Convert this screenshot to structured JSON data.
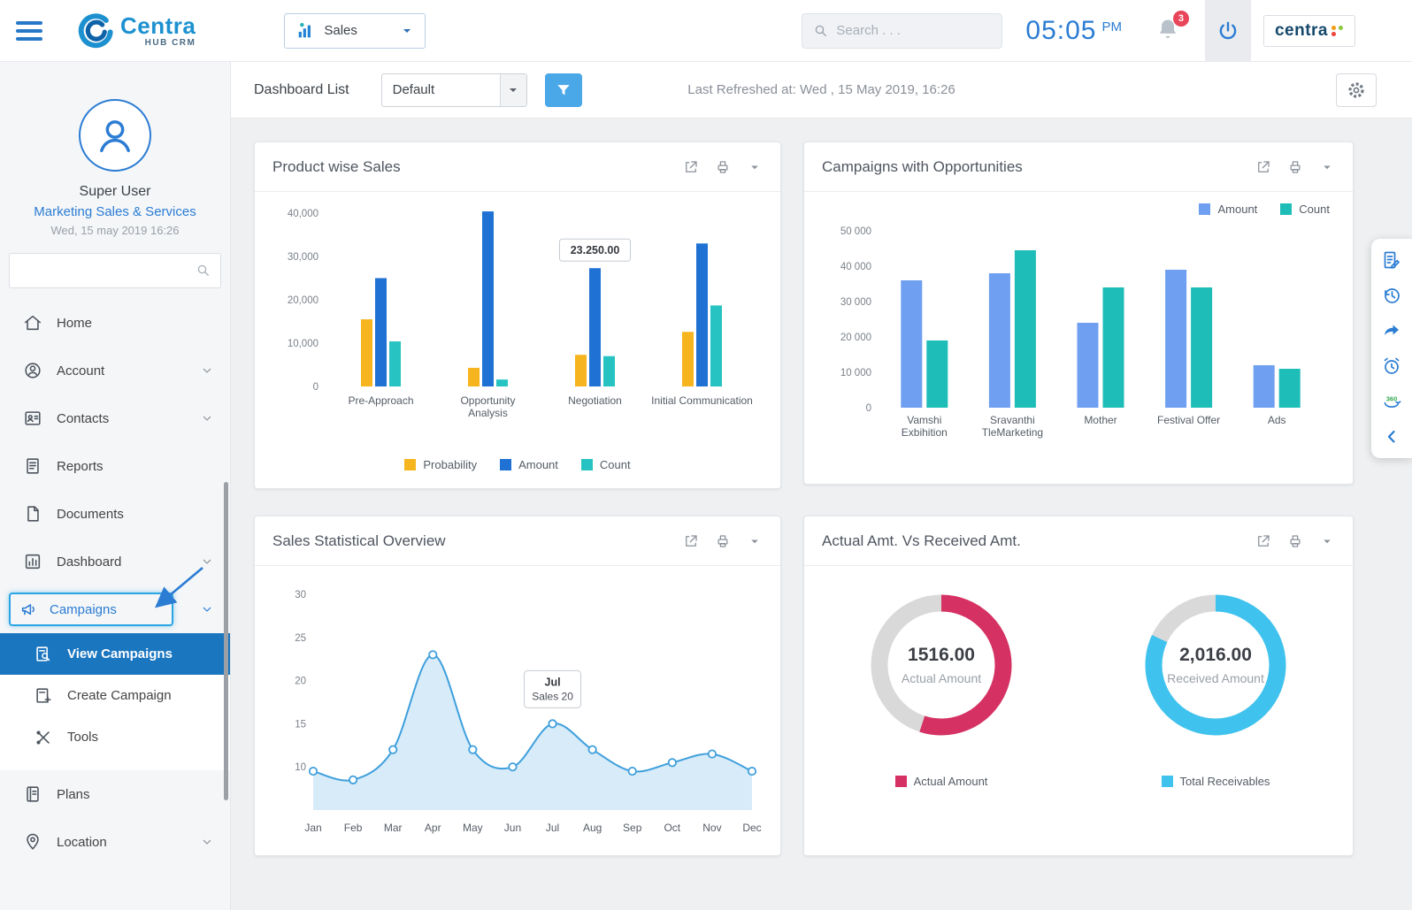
{
  "topbar": {
    "logo": {
      "name": "Centra",
      "sub": "HUB CRM"
    },
    "module_selector": {
      "value": "Sales"
    },
    "search": {
      "placeholder": "Search . . ."
    },
    "clock": {
      "time": "05:05",
      "period": "PM"
    },
    "notifications": {
      "count": "3"
    },
    "brand_right": "centra"
  },
  "filterbar": {
    "dashboard_list_label": "Dashboard List",
    "dashboard_selector": {
      "value": "Default"
    },
    "last_refreshed": "Last Refreshed at: Wed , 15 May 2019, 16:26"
  },
  "sidebar": {
    "user": {
      "name": "Super User",
      "role": "Marketing Sales & Services",
      "datetime": "Wed, 15 may 2019 16:26"
    },
    "items": [
      {
        "label": "Home",
        "icon": "home-icon",
        "expandable": false
      },
      {
        "label": "Account",
        "icon": "account-icon",
        "expandable": true
      },
      {
        "label": "Contacts",
        "icon": "contacts-icon",
        "expandable": true
      },
      {
        "label": "Reports",
        "icon": "reports-icon",
        "expandable": false
      },
      {
        "label": "Documents",
        "icon": "documents-icon",
        "expandable": false
      },
      {
        "label": "Dashboard",
        "icon": "dashboard-icon",
        "expandable": true
      },
      {
        "label": "Campaigns",
        "icon": "campaigns-icon",
        "expandable": true,
        "highlighted": true
      },
      {
        "label": "View Campaigns",
        "icon": "view-campaigns-icon",
        "submenu": true,
        "active": true
      },
      {
        "label": "Create Campaign",
        "icon": "create-campaign-icon",
        "submenu": true
      },
      {
        "label": "Tools",
        "icon": "tools-icon",
        "submenu": true
      },
      {
        "label": "Plans",
        "icon": "plans-icon",
        "expandable": false
      },
      {
        "label": "Location",
        "icon": "location-icon",
        "expandable": true
      }
    ]
  },
  "dock": {
    "items": [
      "activity-log-icon",
      "history-icon",
      "share-icon",
      "reminder-icon",
      "view-360-icon",
      "collapse-dock-icon"
    ]
  },
  "chart_data": [
    {
      "id": "product-wise-sales",
      "type": "bar",
      "title": "Product wise Sales",
      "categories": [
        "Pre-Approach",
        "Opportunity\nAnalysis",
        "Negotiation",
        "Initial Communication"
      ],
      "series": [
        {
          "name": "Probability",
          "color": "#f6b51e",
          "values": [
            15500,
            4300,
            7300,
            12600
          ]
        },
        {
          "name": "Amount",
          "color": "#1f72d4",
          "values": [
            25000,
            40400,
            27300,
            33000
          ]
        },
        {
          "name": "Count",
          "color": "#27c3c3",
          "values": [
            10400,
            1600,
            7000,
            18700
          ]
        }
      ],
      "ylim": [
        0,
        40000
      ],
      "yticks": [
        {
          "v": 0,
          "label": "0"
        },
        {
          "v": 10000,
          "label": "10,000"
        },
        {
          "v": 20000,
          "label": "20,000"
        },
        {
          "v": 30000,
          "label": "30,000"
        },
        {
          "v": 40000,
          "label": "40,000"
        }
      ],
      "legend_position": "bottom",
      "tooltip": {
        "text": "23.250.00",
        "series": "Amount",
        "category_index": 2
      }
    },
    {
      "id": "campaigns-with-opportunities",
      "type": "bar",
      "title": "Campaigns with Opportunities",
      "categories": [
        "Vamshi\nExbihition",
        "Sravanthi\nTleMarketing",
        "Mother",
        "Festival Offer",
        "Ads"
      ],
      "series": [
        {
          "name": "Amount",
          "color": "#6e9ff0",
          "values": [
            36000,
            38000,
            24000,
            39000,
            12000
          ]
        },
        {
          "name": "Count",
          "color": "#1fbdb8",
          "values": [
            19000,
            44500,
            34000,
            34000,
            11000
          ]
        }
      ],
      "ylim": [
        0,
        50000
      ],
      "yticks": [
        {
          "v": 0,
          "label": "0"
        },
        {
          "v": 10000,
          "label": "10 000"
        },
        {
          "v": 20000,
          "label": "20 000"
        },
        {
          "v": 30000,
          "label": "30 000"
        },
        {
          "v": 40000,
          "label": "40 000"
        },
        {
          "v": 50000,
          "label": "50 000"
        }
      ],
      "legend_position": "top-right"
    },
    {
      "id": "sales-statistical-overview",
      "type": "line",
      "title": "Sales Statistical Overview",
      "x": [
        "Jan",
        "Feb",
        "Mar",
        "Apr",
        "May",
        "Jun",
        "Jul",
        "Aug",
        "Sep",
        "Oct",
        "Nov",
        "Dec"
      ],
      "series": [
        {
          "name": "Sales",
          "color": "#3e9fdc",
          "fill": "#d7ebf9",
          "values": [
            9.5,
            8.5,
            12,
            23,
            12,
            10,
            15,
            12,
            9.5,
            10.5,
            11.5,
            9.5
          ]
        }
      ],
      "ylim": [
        5,
        30
      ],
      "yticks": [
        {
          "v": 10,
          "label": "10"
        },
        {
          "v": 15,
          "label": "15"
        },
        {
          "v": 20,
          "label": "20"
        },
        {
          "v": 25,
          "label": "25"
        },
        {
          "v": 30,
          "label": "30"
        }
      ],
      "tooltip": {
        "lines": [
          "Jul",
          "Sales 20"
        ],
        "x_index": 6
      }
    },
    {
      "id": "actual-vs-received",
      "type": "donut-pair",
      "title": "Actual Amt. Vs Received Amt.",
      "donuts": [
        {
          "value": "1516.00",
          "label": "Actual Amount",
          "percent": 55,
          "color": "#d63163",
          "track": "#d9d9d9"
        },
        {
          "value": "2,016.00",
          "label": "Received Amount",
          "percent": 82,
          "color": "#3fc3ee",
          "track": "#d9d9d9"
        }
      ],
      "legend": [
        {
          "label": "Actual Amount",
          "color": "#d63163"
        },
        {
          "label": "Total Receivables",
          "color": "#3fc3ee"
        }
      ]
    }
  ]
}
